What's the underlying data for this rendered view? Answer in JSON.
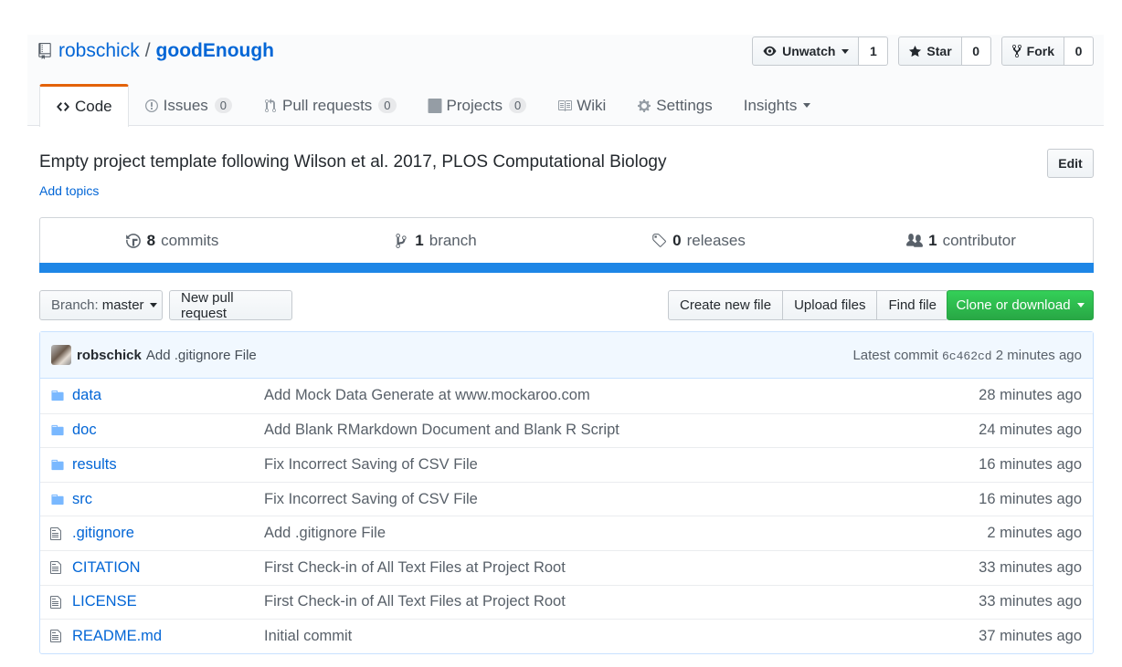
{
  "repo": {
    "owner": "robschick",
    "name": "goodEnough",
    "description": "Empty project template following Wilson et al. 2017, PLOS Computational Biology",
    "add_topics": "Add topics",
    "edit_label": "Edit"
  },
  "actions": {
    "watch_label": "Unwatch",
    "watch_count": "1",
    "star_label": "Star",
    "star_count": "0",
    "fork_label": "Fork",
    "fork_count": "0"
  },
  "tabs": [
    {
      "label": "Code",
      "count": "",
      "icon": "code-icon"
    },
    {
      "label": "Issues",
      "count": "0",
      "icon": "issue-icon"
    },
    {
      "label": "Pull requests",
      "count": "0",
      "icon": "pull-request-icon"
    },
    {
      "label": "Projects",
      "count": "0",
      "icon": "project-icon"
    },
    {
      "label": "Wiki",
      "count": "",
      "icon": "book-icon"
    },
    {
      "label": "Settings",
      "count": "",
      "icon": "gear-icon"
    },
    {
      "label": "Insights",
      "count": "",
      "icon": ""
    }
  ],
  "summary": {
    "commits_num": "8",
    "commits_label": "commits",
    "branches_num": "1",
    "branches_label": "branch",
    "releases_num": "0",
    "releases_label": "releases",
    "contributors_num": "1",
    "contributors_label": "contributor",
    "language_color": "#1e86e6"
  },
  "filenav": {
    "branch_prefix": "Branch:",
    "branch_name": "master",
    "new_pr": "New pull request",
    "create_file": "Create new file",
    "upload_files": "Upload files",
    "find_file": "Find file",
    "clone": "Clone or download"
  },
  "commit": {
    "author": "robschick",
    "message": "Add .gitignore File",
    "latest_prefix": "Latest commit",
    "sha": "6c462cd",
    "age": "2 minutes ago"
  },
  "files": [
    {
      "type": "dir",
      "name": "data",
      "message": "Add Mock Data Generate at www.mockaroo.com",
      "age": "28 minutes ago"
    },
    {
      "type": "dir",
      "name": "doc",
      "message": "Add Blank RMarkdown Document and Blank R Script",
      "age": "24 minutes ago"
    },
    {
      "type": "dir",
      "name": "results",
      "message": "Fix Incorrect Saving of CSV File",
      "age": "16 minutes ago"
    },
    {
      "type": "dir",
      "name": "src",
      "message": "Fix Incorrect Saving of CSV File",
      "age": "16 minutes ago"
    },
    {
      "type": "file",
      "name": ".gitignore",
      "message": "Add .gitignore File",
      "age": "2 minutes ago"
    },
    {
      "type": "file",
      "name": "CITATION",
      "message": "First Check-in of All Text Files at Project Root",
      "age": "33 minutes ago"
    },
    {
      "type": "file",
      "name": "LICENSE",
      "message": "First Check-in of All Text Files at Project Root",
      "age": "33 minutes ago"
    },
    {
      "type": "file",
      "name": "README.md",
      "message": "Initial commit",
      "age": "37 minutes ago"
    }
  ]
}
